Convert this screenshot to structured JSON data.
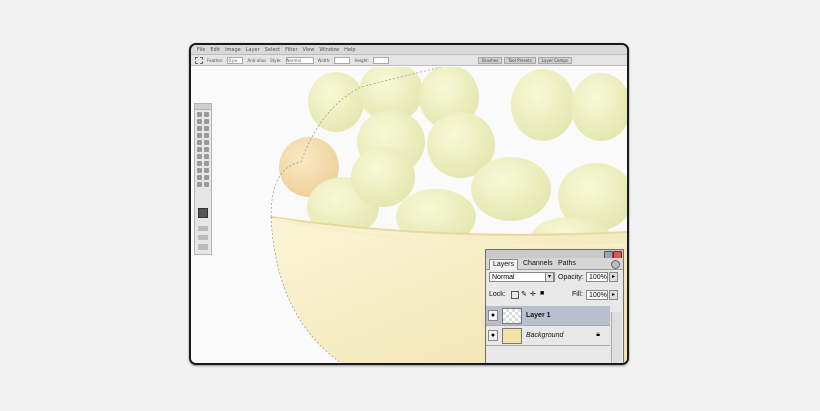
{
  "menubar": {
    "items": [
      "File",
      "Edit",
      "Image",
      "Layer",
      "Select",
      "Filter",
      "View",
      "Window",
      "Help"
    ]
  },
  "options_bar": {
    "feather_label": "Feather:",
    "feather_value": "0 px",
    "antialias_label": "Anti-alias",
    "style_label": "Style:",
    "style_value": "Normal",
    "width_label": "Width:",
    "height_label": "Height:"
  },
  "workspace_tabs": [
    "Brushes",
    "Tool Presets",
    "Layer Comps"
  ],
  "layers_panel": {
    "tabs": [
      "Layers",
      "Channels",
      "Paths"
    ],
    "blend_mode": "Normal",
    "opacity_label": "Opacity:",
    "opacity_value": "100%",
    "lock_label": "Lock:",
    "fill_label": "Fill:",
    "fill_value": "100%",
    "layers": [
      {
        "name": "Layer 1",
        "selected": true
      },
      {
        "name": "Background",
        "selected": false
      }
    ],
    "bottom_icons": [
      "link-icon",
      "fx-icon",
      "mask-icon",
      "adjustment-icon",
      "group-icon",
      "new-layer-icon",
      "trash-icon"
    ]
  },
  "colors": {
    "accent_selected": "#b9bfcc",
    "bowl": "#f6efc4",
    "grape": "#eef0c0",
    "grape_warm": "#f5dcae"
  }
}
